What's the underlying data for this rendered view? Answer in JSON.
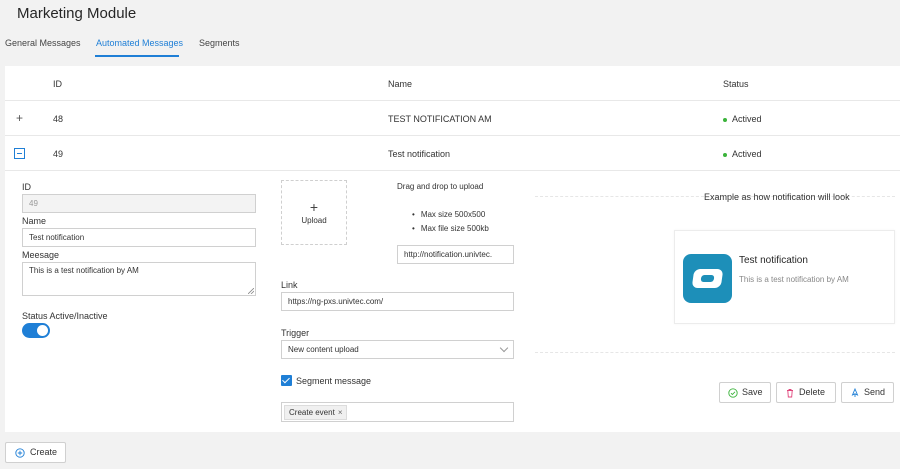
{
  "page": {
    "title": "Marketing Module"
  },
  "tabs": [
    {
      "label": "General Messages",
      "active": false
    },
    {
      "label": "Automated Messages",
      "active": true
    },
    {
      "label": "Segments",
      "active": false
    }
  ],
  "table": {
    "columns": [
      "ID",
      "Name",
      "Status"
    ],
    "rows": [
      {
        "id": "48",
        "name": "TEST NOTIFICATION AM",
        "status": "Actived",
        "expanded": false
      },
      {
        "id": "49",
        "name": "Test notification",
        "status": "Actived",
        "expanded": true
      }
    ]
  },
  "form": {
    "id_label": "ID",
    "id_value": "49",
    "name_label": "Name",
    "name_value": "Test notification",
    "message_label": "Meesage",
    "message_value": "This is a test notification by AM",
    "status_label": "Status Active/Inactive",
    "status_active": true,
    "upload_plus": "+",
    "upload_label": "Upload",
    "drag_text": "Drag and drop to upload",
    "upload_rules": [
      "Max size 500x500",
      "Max file size 500kb"
    ],
    "upload_url": "http://notification.univtec.",
    "link_label": "Link",
    "link_value": "https://ng-pxs.univtec.com/",
    "trigger_label": "Trigger",
    "trigger_value": "New content upload",
    "segment_checked": true,
    "segment_label": "Segment message",
    "segment_tag": "Create event",
    "segment_tag_remove": "×"
  },
  "preview": {
    "heading": "Example as how notification will look",
    "notification_title": "Test notification",
    "notification_message": "This is a test notification by AM"
  },
  "actions": {
    "save_label": "Save",
    "delete_label": "Delete",
    "send_label": "Send",
    "create_label": "Create"
  },
  "colors": {
    "accent": "#1f7fd6",
    "status_green": "#3bb33b",
    "delete_pink": "#e0457b",
    "save_green": "#3bb33b",
    "app_icon": "#1d8fb9"
  }
}
